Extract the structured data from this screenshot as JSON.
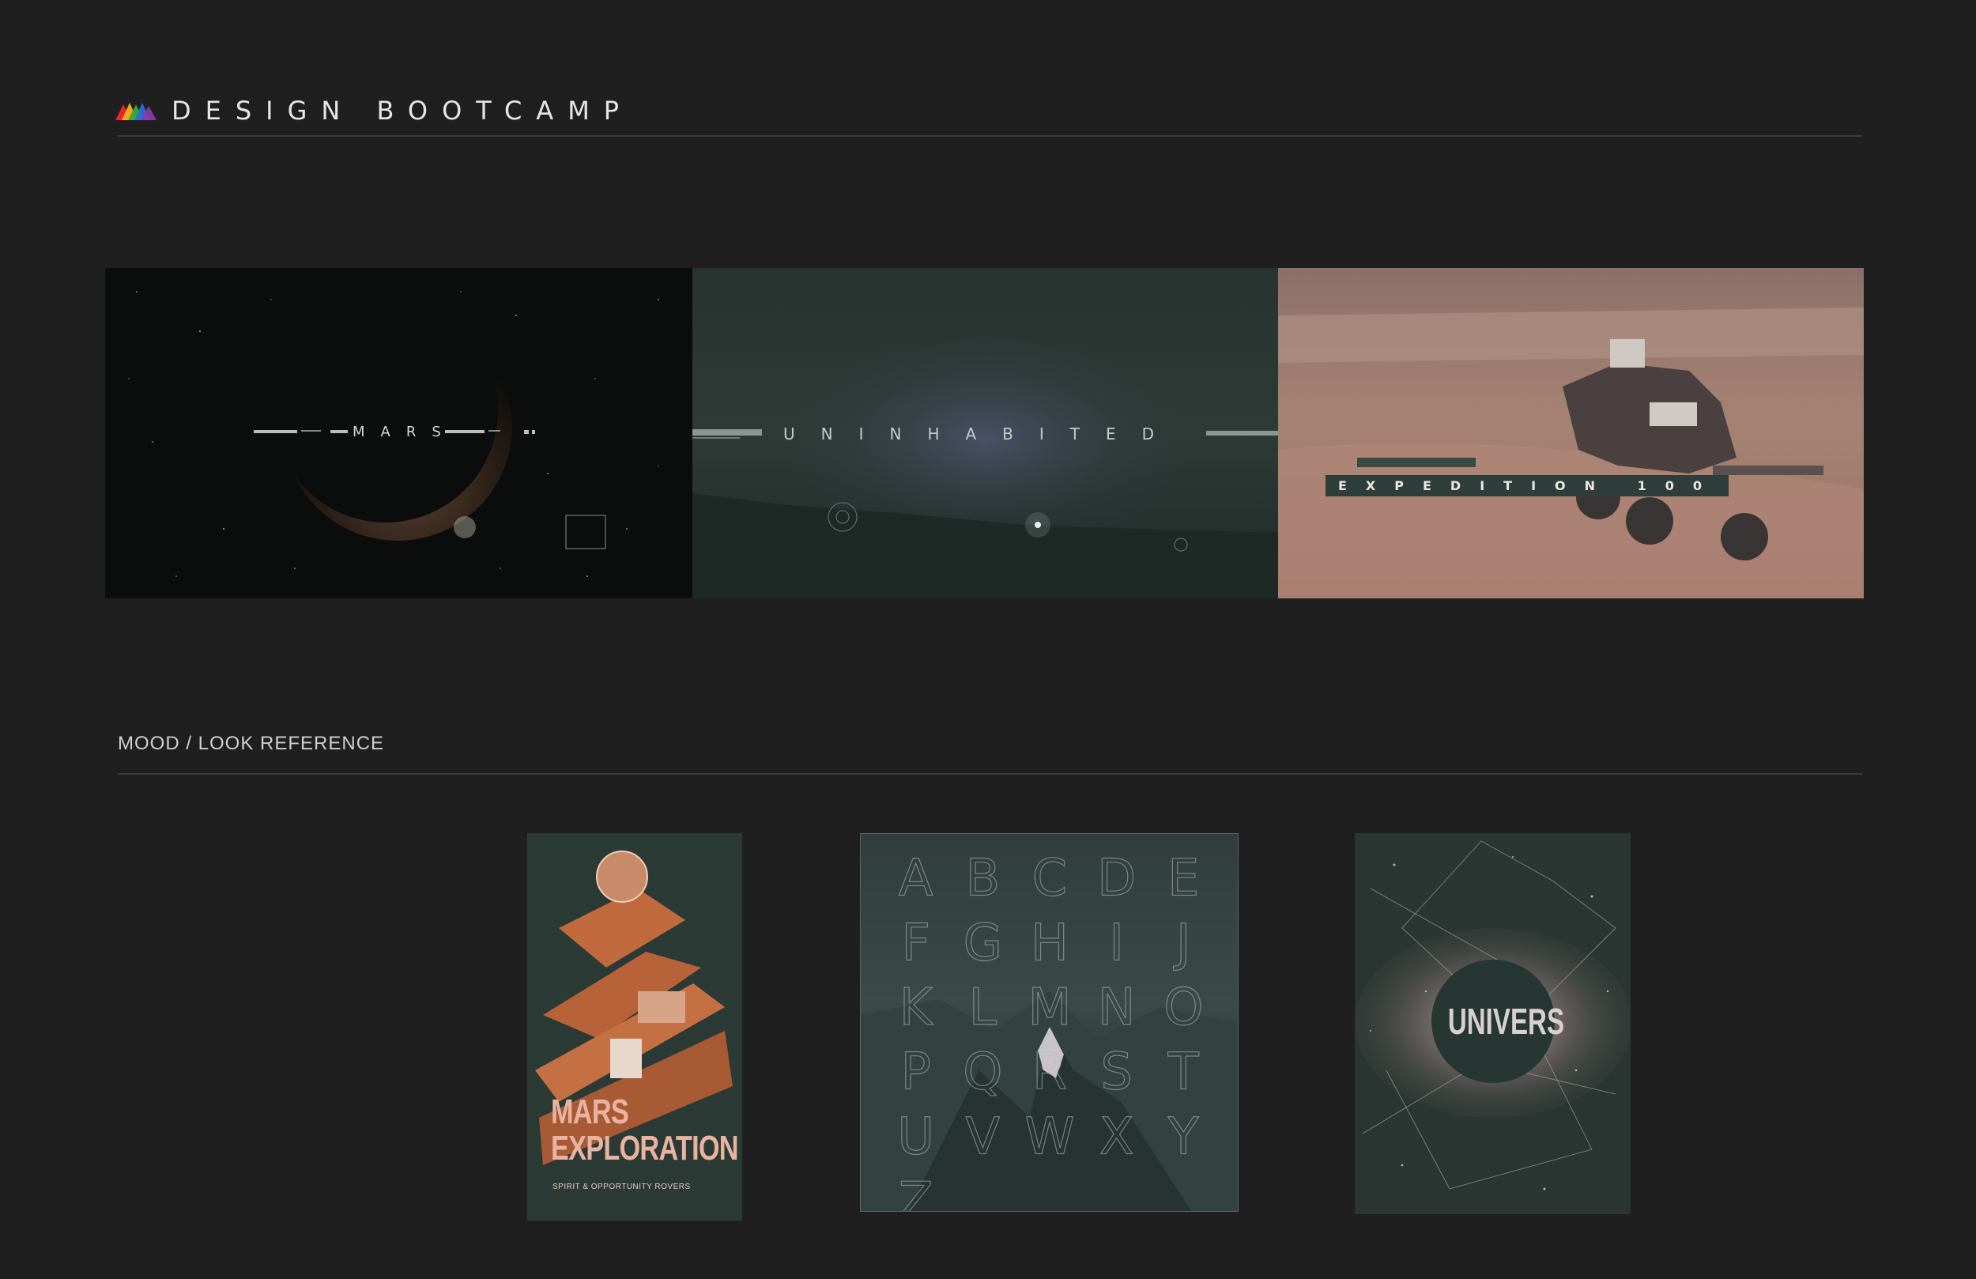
{
  "header": {
    "brand": "DESIGN BOOTCAMP",
    "logo_icon": "tri-color-mountain-logo",
    "logo_colors": [
      "#e8242d",
      "#f7b21b",
      "#3aaa35",
      "#2e6fd8",
      "#8b3aa7"
    ]
  },
  "storyboard": {
    "frames": [
      {
        "title": "MARS"
      },
      {
        "title": "UNINHABITED"
      },
      {
        "title": "EXPEDITION 100"
      }
    ]
  },
  "section": {
    "title": "MOOD / LOOK REFERENCE"
  },
  "posters": {
    "mars": {
      "title_line1": "MARS",
      "title_line2": "EXPLORATION",
      "subtitle": "SPIRIT & OPPORTUNITY ROVERS"
    },
    "alphabet": {
      "letters": [
        "A",
        "B",
        "C",
        "D",
        "E",
        "F",
        "G",
        "H",
        "I",
        "J",
        "K",
        "L",
        "M",
        "N",
        "O",
        "P",
        "Q",
        "R",
        "S",
        "T",
        "U",
        "V",
        "W",
        "X",
        "Y",
        "Z"
      ]
    },
    "univers": {
      "title": "UNIVERS"
    }
  },
  "colors": {
    "background": "#1f1f1f",
    "rule": "#3c3c3c",
    "text": "#cfcfcf"
  }
}
